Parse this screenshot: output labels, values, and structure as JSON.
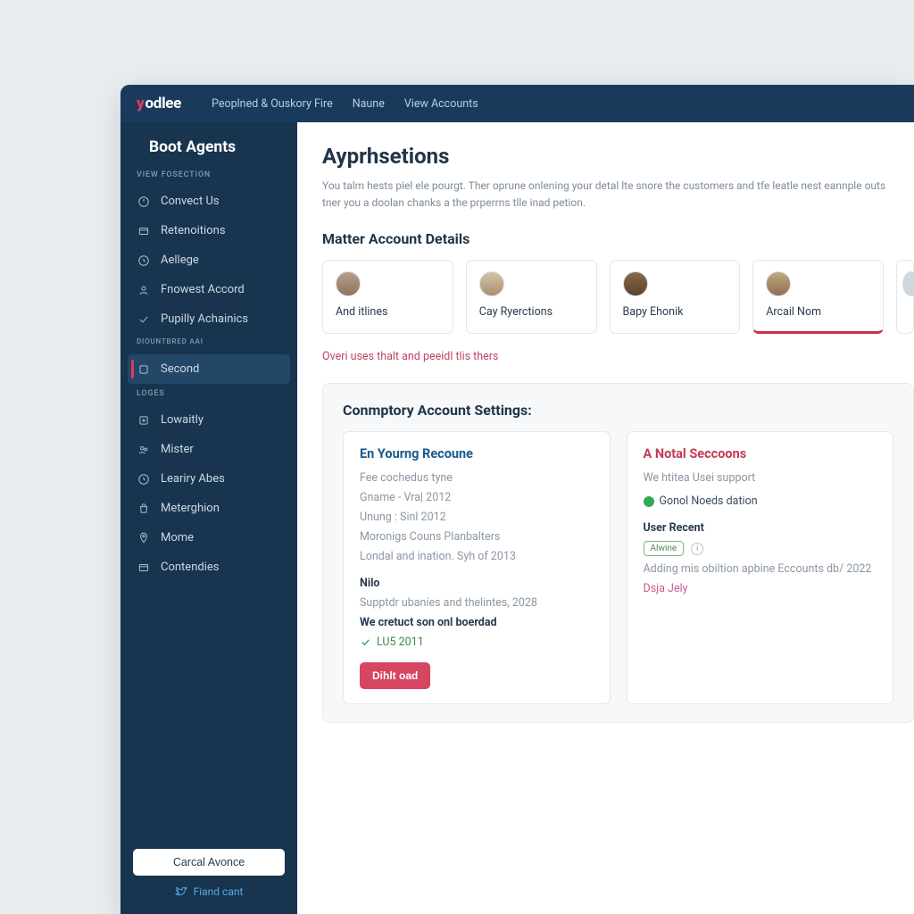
{
  "brand": "odlee",
  "topnav": {
    "item0": "Peoplned & Ouskory Fire",
    "item1": "Naune",
    "item2": "View Accounts"
  },
  "sidebar": {
    "title": "Boot Agents",
    "caption1": "VIEW FOSECTION",
    "group1": {
      "i0": "Convect Us",
      "i1": "Retenoitions",
      "i2": "Aellege",
      "i3": "Fnowest Accord",
      "i4": "Pupilly Achainics"
    },
    "caption2": "Diountbred Aai",
    "active": "Second",
    "caption3": "LOGES",
    "group2": {
      "i0": "Lowaitly",
      "i1": "Mister",
      "i2": "Leariry Abes",
      "i3": "Meterghion",
      "i4": "Mome",
      "i5": "Contendies"
    },
    "cancel": "Carcal Avonce",
    "footer_link": "Fiand cant"
  },
  "main": {
    "title": "Ayprhsetions",
    "desc": "You talm hests piel ele pourgt. Ther oprune onlening your detal lte snore the customers and tfe leatle nest eannple outs tner you a doolan chanks a the prperrns tlle inad petion.",
    "section_h": "Matter Account Details",
    "cards": {
      "c0": "And itlines",
      "c1": "Cay Ryerctions",
      "c2": "Bapy Ehonik",
      "c3": "Arcail Nom"
    },
    "helper": "Overi uses thalt and peeidl tlis thers",
    "settings_h": "Conmptory Account Settings:",
    "left_panel": {
      "title": "En Yourng Recoune",
      "l0": "Fee cochedus tyne",
      "l1": "Gname - Vra| 2012",
      "l2": "Unung : Sinl 2012",
      "l3": "Moronigs Couns Planbalters",
      "l4": "Londal and ination. Syh of 2013",
      "sub": "Nilo",
      "l5": "Supptdr ubanies and thelintes, 2028",
      "bold": "We cretuct son onl boerdad",
      "check": "LU5 2011",
      "btn": "Dihlt oad"
    },
    "right_panel": {
      "title": "A Notal Seccoons",
      "sub": "We htitea Usei support",
      "status": "Gonol Noeds dation",
      "label": "User Recent",
      "tag": "Alwine",
      "line": "Adding mis obiltion apbine Eccounts db/ 2022",
      "pink": "Dsja Jely"
    }
  }
}
